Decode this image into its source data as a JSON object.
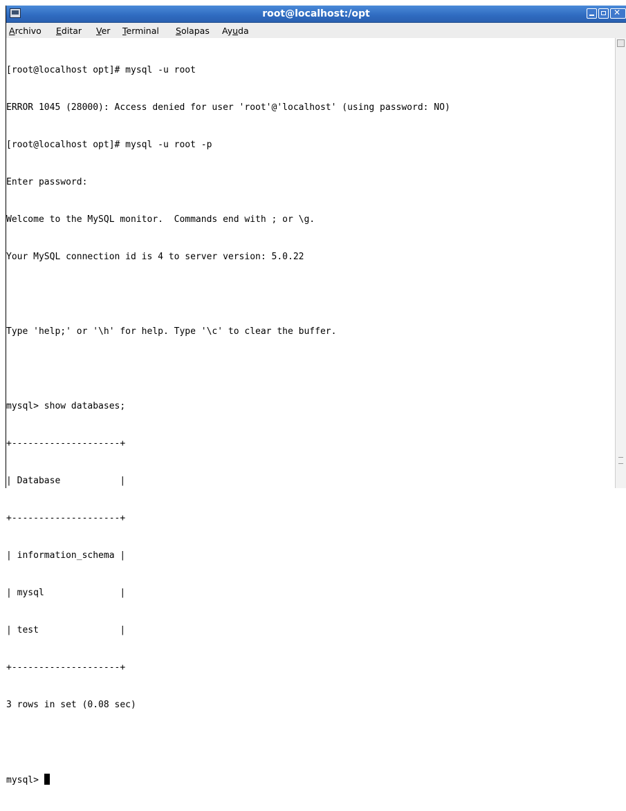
{
  "window": {
    "title": "root@localhost:/opt"
  },
  "menubar": {
    "items": [
      {
        "key": "A",
        "rest": "rchivo"
      },
      {
        "key": "E",
        "rest": "ditar"
      },
      {
        "key": "V",
        "rest": "er"
      },
      {
        "key": "T",
        "rest": "erminal"
      },
      {
        "key": "S",
        "rest": "olapas"
      },
      {
        "pre": "Ay",
        "key": "u",
        "rest": "da"
      }
    ]
  },
  "terminal": {
    "lines": [
      "[root@localhost opt]# mysql -u root",
      "ERROR 1045 (28000): Access denied for user 'root'@'localhost' (using password: NO)",
      "[root@localhost opt]# mysql -u root -p",
      "Enter password:",
      "Welcome to the MySQL monitor.  Commands end with ; or \\g.",
      "Your MySQL connection id is 4 to server version: 5.0.22",
      "",
      "Type 'help;' or '\\h' for help. Type '\\c' to clear the buffer.",
      "",
      "mysql> show databases;",
      "+--------------------+",
      "| Database           |",
      "+--------------------+",
      "| information_schema |",
      "| mysql              |",
      "| test               |",
      "+--------------------+",
      "3 rows in set (0.08 sec)",
      "",
      "mysql> "
    ]
  },
  "icons": {
    "window_menu": "window-menu-icon",
    "minimize": "minimize-icon",
    "maximize": "maximize-icon",
    "close": "close-icon",
    "scroll_up": "scroll-up-arrow-icon"
  },
  "colors": {
    "titlebar": "#2f6bc0",
    "menubar": "#ededed",
    "terminal_bg": "#ffffff",
    "terminal_fg": "#000000"
  }
}
